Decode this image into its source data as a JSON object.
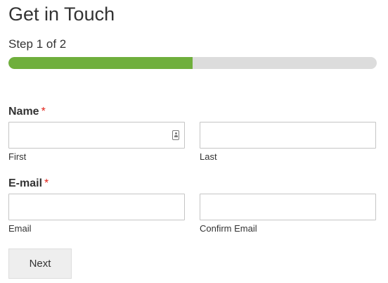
{
  "form": {
    "title": "Get in Touch",
    "step_text": "Step 1 of 2",
    "progress_fraction": 0.5,
    "colors": {
      "progress_fill": "#6faf3c",
      "progress_track": "#dcdcdc",
      "required_marker": "#e2231a"
    }
  },
  "name_group": {
    "label": "Name",
    "required_marker": "*",
    "first": {
      "sublabel": "First",
      "value": "",
      "icon": "contact-card-icon"
    },
    "last": {
      "sublabel": "Last",
      "value": ""
    }
  },
  "email_group": {
    "label": "E-mail",
    "required_marker": "*",
    "email": {
      "sublabel": "Email",
      "value": ""
    },
    "confirm": {
      "sublabel": "Confirm Email",
      "value": ""
    }
  },
  "actions": {
    "next_label": "Next"
  }
}
